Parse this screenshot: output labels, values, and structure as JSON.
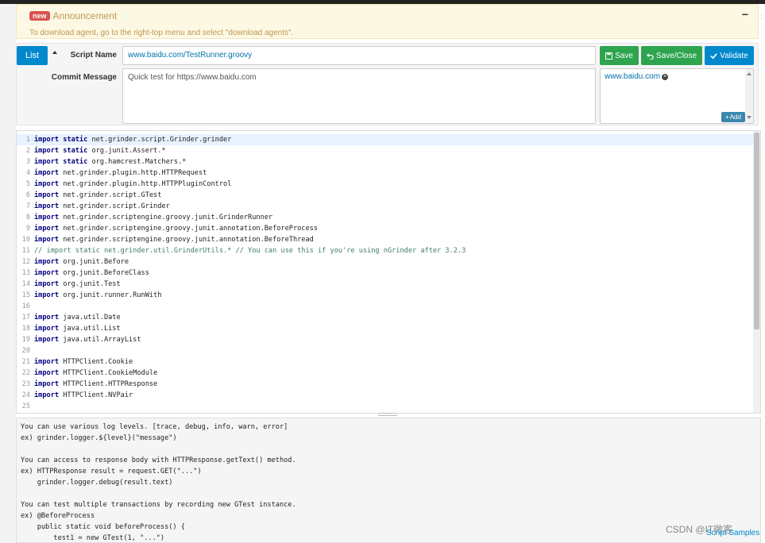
{
  "announcement": {
    "badge": "new",
    "title": "Announcement",
    "minimize": "−",
    "text": "To download agent, go to the right-top menu and select \"download agents\"."
  },
  "form": {
    "list_label": "List",
    "script_name_label": "Script Name",
    "script_name_value": "www.baidu.com/TestRunner.groovy",
    "commit_message_label": "Commit Message",
    "commit_message_value": "Quick test for https://www.baidu.com",
    "save_label": "Save",
    "save_close_label": "Save/Close",
    "validate_label": "Validate",
    "hosts": [
      {
        "name": "www.baidu.com"
      }
    ],
    "add_label": "Add"
  },
  "editor": {
    "lines": [
      {
        "num": "1",
        "kw": "import static",
        "rest": " net.grinder.script.Grinder.grinder"
      },
      {
        "num": "2",
        "kw": "import static",
        "rest": " org.junit.Assert.*"
      },
      {
        "num": "3",
        "kw": "import static",
        "rest": " org.hamcrest.Matchers.*"
      },
      {
        "num": "4",
        "kw": "import",
        "rest": " net.grinder.plugin.http.HTTPRequest"
      },
      {
        "num": "5",
        "kw": "import",
        "rest": " net.grinder.plugin.http.HTTPPluginControl"
      },
      {
        "num": "6",
        "kw": "import",
        "rest": " net.grinder.script.GTest"
      },
      {
        "num": "7",
        "kw": "import",
        "rest": " net.grinder.script.Grinder"
      },
      {
        "num": "8",
        "kw": "import",
        "rest": " net.grinder.scriptengine.groovy.junit.GrinderRunner"
      },
      {
        "num": "9",
        "kw": "import",
        "rest": " net.grinder.scriptengine.groovy.junit.annotation.BeforeProcess"
      },
      {
        "num": "10",
        "kw": "import",
        "rest": " net.grinder.scriptengine.groovy.junit.annotation.BeforeThread"
      },
      {
        "num": "11",
        "kw": "",
        "rest": "",
        "comment": "// import static net.grinder.util.GrinderUtils.* // You can use this if you're using nGrinder after 3.2.3"
      },
      {
        "num": "12",
        "kw": "import",
        "rest": " org.junit.Before"
      },
      {
        "num": "13",
        "kw": "import",
        "rest": " org.junit.BeforeClass"
      },
      {
        "num": "14",
        "kw": "import",
        "rest": " org.junit.Test"
      },
      {
        "num": "15",
        "kw": "import",
        "rest": " org.junit.runner.RunWith"
      },
      {
        "num": "16",
        "kw": "",
        "rest": ""
      },
      {
        "num": "17",
        "kw": "import",
        "rest": " java.util.Date"
      },
      {
        "num": "18",
        "kw": "import",
        "rest": " java.util.List"
      },
      {
        "num": "19",
        "kw": "import",
        "rest": " java.util.ArrayList"
      },
      {
        "num": "20",
        "kw": "",
        "rest": ""
      },
      {
        "num": "21",
        "kw": "import",
        "rest": " HTTPClient.Cookie"
      },
      {
        "num": "22",
        "kw": "import",
        "rest": " HTTPClient.CookieModule"
      },
      {
        "num": "23",
        "kw": "import",
        "rest": " HTTPClient.HTTPResponse"
      },
      {
        "num": "24",
        "kw": "import",
        "rest": " HTTPClient.NVPair"
      },
      {
        "num": "25",
        "kw": "",
        "rest": ""
      }
    ]
  },
  "samples": {
    "lines": [
      "You can use various log levels. [trace, debug, info, warn, error]",
      "ex) grinder.logger.${level}(\"message\")",
      "",
      "You can access to response body with HTTPResponse.getText() method.",
      "ex) HTTPResponse result = request.GET(\"...\")",
      "    grinder.logger.debug(result.text)",
      "",
      "You can test multiple transactions by recording new GTest instance.",
      "ex) @BeforeProcess",
      "    public static void beforeProcess() {",
      "        test1 = new GTest(1, \"...\")"
    ],
    "link_label": "Script Samples"
  },
  "watermark": "CSDN @IT微客",
  "colors": {
    "accent_blue": "#0088cc",
    "save_green": "#2ea44f",
    "keyword": "#00007f",
    "comment": "#3f7f5f"
  }
}
